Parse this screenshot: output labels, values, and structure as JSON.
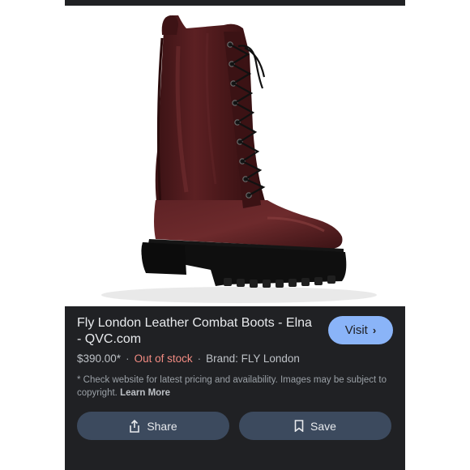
{
  "product": {
    "title": "Fly London Leather Combat Boots - Elna - QVC.com",
    "price": "$390.00*",
    "stock_status": "Out of stock",
    "brand": "Brand: FLY London",
    "separator": "·"
  },
  "disclaimer": {
    "text": "* Check website for latest pricing and availability. Images may be subject to copyright.",
    "link_label": "Learn More"
  },
  "actions": {
    "visit_label": "Visit",
    "share_label": "Share",
    "save_label": "Save"
  },
  "icons": {
    "visit": "chevron-right-icon",
    "share": "share-icon",
    "save": "bookmark-icon"
  },
  "colors": {
    "panel_bg": "#202124",
    "visit_button": "#8ab4f8",
    "action_button": "#3c4a5e",
    "out_of_stock": "#f28b82",
    "boot_leather": "#4a1a1c"
  }
}
